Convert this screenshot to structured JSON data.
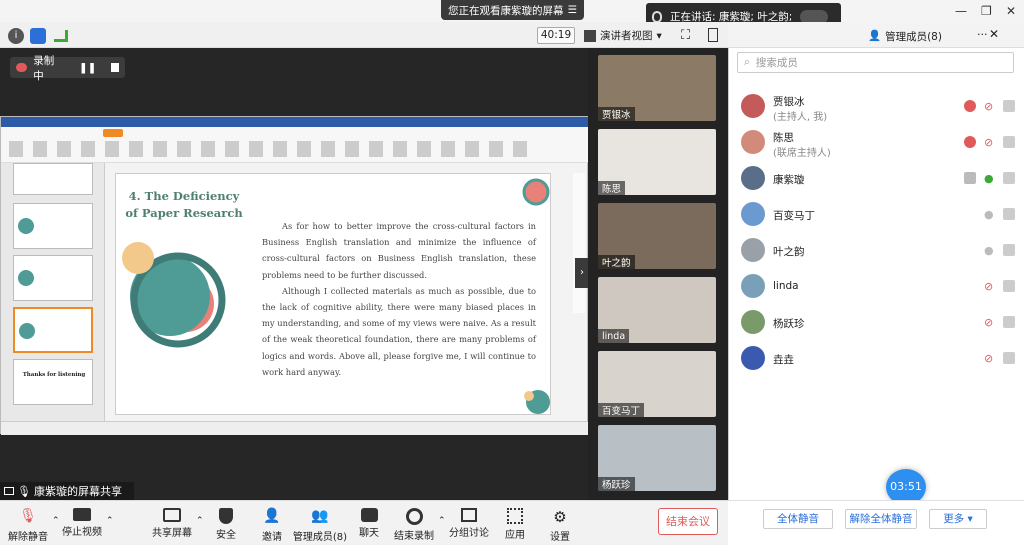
{
  "top": {
    "viewing_text": "您正在观看康紫璇的屏幕",
    "viewing_menu_icon": "menu-icon",
    "speaking_text": "正在讲话: 康紫璇; 叶之韵;",
    "timer": "40:19",
    "view_mode": "演讲者视图",
    "chat_tab": "聊天",
    "members_tab": "管理成员(8)"
  },
  "recording": {
    "label": "录制中"
  },
  "slide": {
    "title": "4. The Deficiency of Paper Research",
    "para1": "As for how to better improve the cross-cultural factors in Business English translation and minimize the influence of cross-cultural factors on Business English translation, these problems need to be further discussed.",
    "para2": "Although I collected materials as much as possible, due to the lack of cognitive ability, there were many biased places in my understanding, and some of my views were naive. As a result of the weak theoretical foundation, there are many problems of logics and words. Above all, please forgive me, I will continue to work hard anyway.",
    "thanks_text": "Thanks for listening"
  },
  "share_label": "康紫璇的屏幕共享",
  "videos": [
    {
      "name": "贾银冰",
      "color": "#8a7a66"
    },
    {
      "name": "陈思",
      "color": "#e8e4e0"
    },
    {
      "name": "叶之韵",
      "color": "#7a6b5c"
    },
    {
      "name": "linda",
      "color": "#cfc8c0"
    },
    {
      "name": "百变马丁",
      "color": "#d8d3cd"
    },
    {
      "name": "杨跃珍",
      "color": "#b8c0c6"
    }
  ],
  "panel": {
    "search_placeholder": "搜索成员",
    "members": [
      {
        "name": "贾银冰",
        "role": "(主持人, 我)",
        "color": "#c45a5a"
      },
      {
        "name": "陈思",
        "role": "(联席主持人)",
        "color": "#d28a7a"
      },
      {
        "name": "康紫璇",
        "role": "",
        "color": "#5a6e8a"
      },
      {
        "name": "百变马丁",
        "role": "",
        "color": "#6a9ad0"
      },
      {
        "name": "叶之韵",
        "role": "",
        "color": "#9aa0a8"
      },
      {
        "name": "linda",
        "role": "",
        "color": "#7aa0b8"
      },
      {
        "name": "杨跃珍",
        "role": "",
        "color": "#7a9a6a"
      },
      {
        "name": "垚垚",
        "role": "",
        "color": "#3a5ab0"
      }
    ],
    "mute_all": "全体静音",
    "unmute_all": "解除全体静音",
    "more": "更多",
    "elapsed": "03:51"
  },
  "bottom": {
    "unmute": "解除静音",
    "stop_video": "停止视频",
    "share": "共享屏幕",
    "security": "安全",
    "invite": "邀请",
    "members": "管理成员(8)",
    "chat": "聊天",
    "end_recording": "结束录制",
    "breakout": "分组讨论",
    "apps": "应用",
    "settings": "设置",
    "end_meeting": "结束会议"
  },
  "colors": {
    "accent": "#2d8ff0",
    "danger": "#e05a5a",
    "slide_teal": "#4f9c96"
  }
}
